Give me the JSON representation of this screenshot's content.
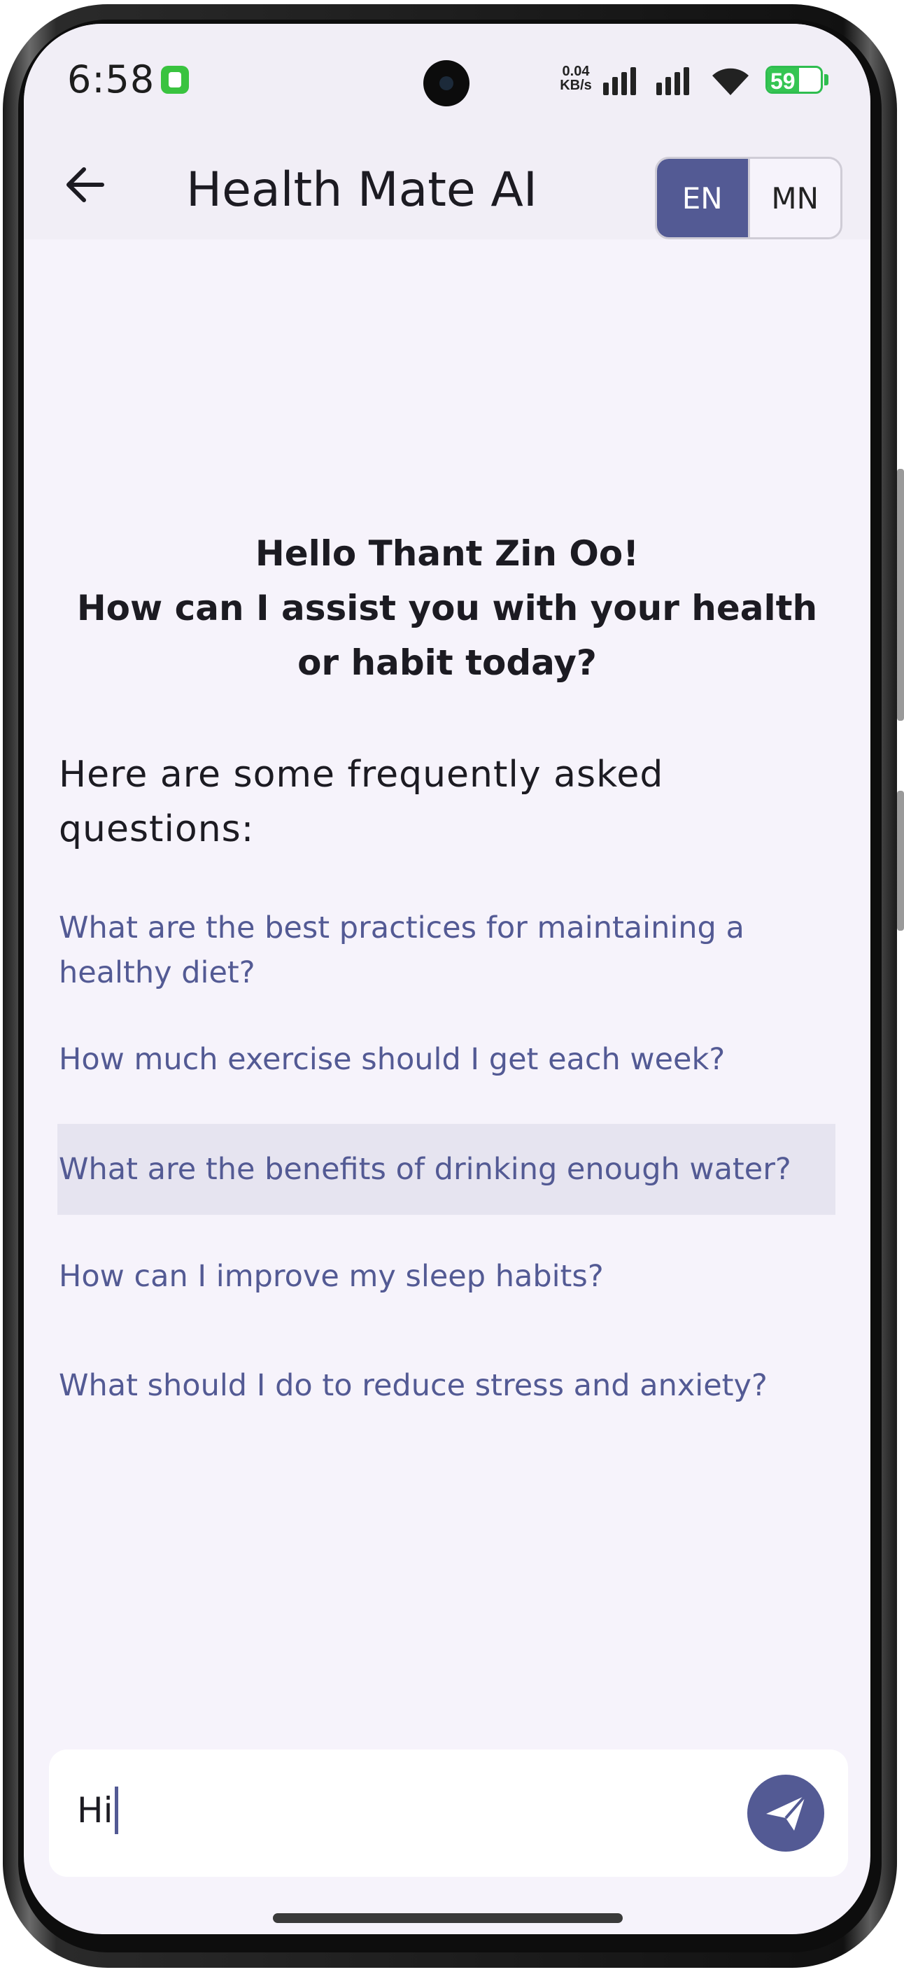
{
  "status_bar": {
    "time": "6:58",
    "net_speed_value": "0.04",
    "net_speed_unit": "KB/s",
    "battery": "59",
    "battery_level": 0.59,
    "icons": [
      "android-notification-icon",
      "signal-icon",
      "signal-icon",
      "wifi-icon",
      "battery-charging-icon"
    ]
  },
  "app_bar": {
    "back_icon": "arrow-left-icon",
    "title": "Health Mate AI",
    "languages": [
      {
        "label": "EN",
        "active": true
      },
      {
        "label": "MN",
        "active": false
      }
    ]
  },
  "main": {
    "greeting_line1": "Hello Thant Zin Oo!",
    "greeting_line2": "How can I assist you with your health or habit today?",
    "faq_heading": "Here are some frequently asked questions:",
    "faqs": [
      {
        "text": "What are the best practices for maintaining a healthy diet?",
        "highlighted": false
      },
      {
        "text": "How much exercise should I get each week?",
        "highlighted": false
      },
      {
        "text": "What are the benefits of drinking enough water?",
        "highlighted": true
      },
      {
        "text": "How can I improve my sleep habits?",
        "highlighted": false
      },
      {
        "text": "What should I do to reduce stress and anxiety?",
        "highlighted": false
      }
    ]
  },
  "composer": {
    "value": "Hi",
    "send_icon": "send-icon"
  },
  "colors": {
    "accent": "#535a94",
    "background": "#f6f3fb",
    "app_bar": "#f1eef6",
    "highlight": "#e6e4f0"
  }
}
